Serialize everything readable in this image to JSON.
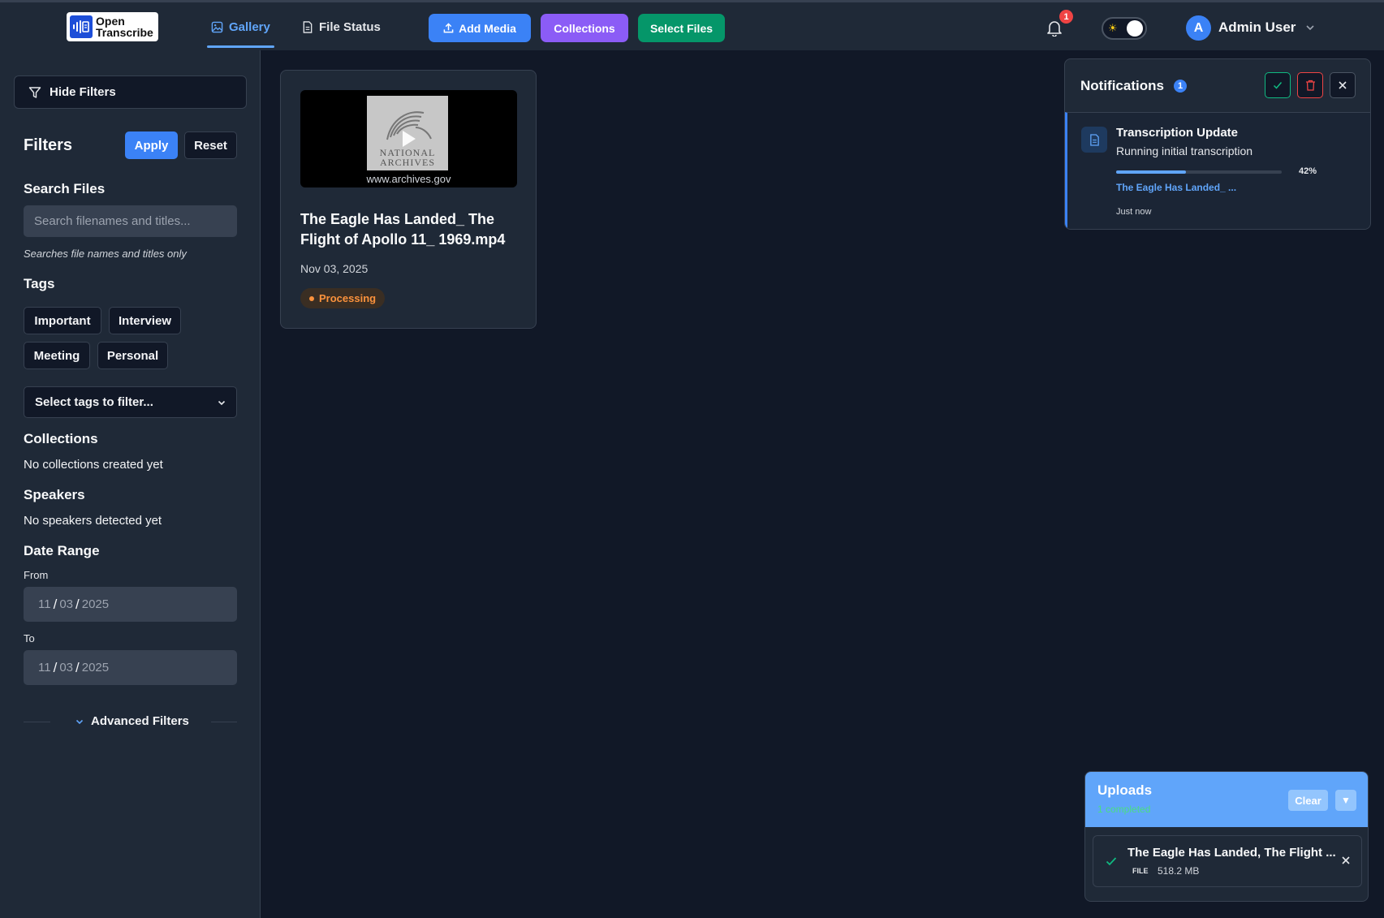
{
  "app": {
    "logo_line1": "Open",
    "logo_line2": "Transcribe"
  },
  "nav": {
    "tabs": [
      {
        "label": "Gallery",
        "icon": "image-icon",
        "active": true
      },
      {
        "label": "File Status",
        "icon": "document-icon",
        "active": false
      }
    ],
    "buttons": [
      {
        "label": "Add Media",
        "icon": "upload-icon",
        "color": "#3b82f6"
      },
      {
        "label": "Collections",
        "color": "#8b5cf6"
      },
      {
        "label": "Select Files",
        "color": "#059669"
      }
    ],
    "notification_badge": "1",
    "theme_icon": "sun-icon",
    "user": {
      "initial": "A",
      "name": "Admin User"
    }
  },
  "sidebar": {
    "hide_filters_label": "Hide Filters",
    "filters_title": "Filters",
    "apply_label": "Apply",
    "reset_label": "Reset",
    "search": {
      "title": "Search Files",
      "placeholder": "Search filenames and titles...",
      "hint": "Searches file names and titles only"
    },
    "tags": {
      "title": "Tags",
      "items": [
        "Important",
        "Interview",
        "Meeting",
        "Personal"
      ],
      "select_placeholder": "Select tags to filter..."
    },
    "collections": {
      "title": "Collections",
      "empty": "No collections created yet"
    },
    "speakers": {
      "title": "Speakers",
      "empty": "No speakers detected yet"
    },
    "date_range": {
      "title": "Date Range",
      "from_label": "From",
      "from": {
        "month": "11",
        "day": "03",
        "year": "2025"
      },
      "to_label": "To",
      "to": {
        "month": "11",
        "day": "03",
        "year": "2025"
      }
    },
    "advanced_label": "Advanced Filters"
  },
  "gallery": {
    "items": [
      {
        "thumb_logo_line1": "NATIONAL",
        "thumb_logo_line2": "ARCHIVES",
        "thumb_url": "www.archives.gov",
        "title": "The Eagle Has Landed_ The Flight of Apollo 11_ 1969.mp4",
        "date": "Nov 03, 2025",
        "status": "Processing",
        "status_color": "#fb923c"
      }
    ]
  },
  "notifications": {
    "title": "Notifications",
    "count": "1",
    "items": [
      {
        "title": "Transcription Update",
        "message": "Running initial transcription",
        "progress": 42,
        "progress_label": "42%",
        "file_link": "The Eagle Has Landed_ ...",
        "time": "Just now"
      }
    ]
  },
  "uploads": {
    "title": "Uploads",
    "subtitle": "1 completed",
    "clear_label": "Clear",
    "collapse_glyph": "▼",
    "items": [
      {
        "name": "The Eagle Has Landed, The Flight ...",
        "type": "FILE",
        "size": "518.2 MB"
      }
    ]
  }
}
